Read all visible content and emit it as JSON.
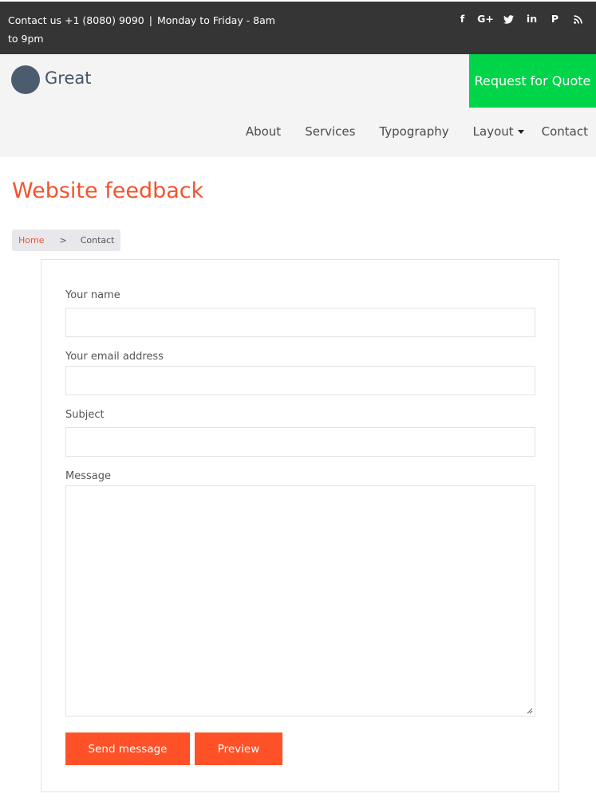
{
  "topbar": {
    "contact": "Contact us +1 (8080) 9090",
    "separator": "|",
    "hours": "Monday to Friday - 8am to 9pm",
    "social": [
      {
        "icon": "facebook-icon",
        "glyph": "f"
      },
      {
        "icon": "google-plus-icon",
        "glyph": "G+"
      },
      {
        "icon": "twitter-icon",
        "glyph": ""
      },
      {
        "icon": "linkedin-icon",
        "glyph": "in"
      },
      {
        "icon": "pinterest-icon",
        "glyph": "P"
      },
      {
        "icon": "rss-icon",
        "glyph": ""
      }
    ]
  },
  "header": {
    "logo_text": "Great",
    "quote_button": "Request for Quote",
    "nav": [
      "About",
      "Services",
      "Typography",
      "Layout",
      "Contact"
    ]
  },
  "page": {
    "title": "Website feedback",
    "breadcrumb": {
      "home": "Home",
      "separator": ">",
      "current": "Contact"
    }
  },
  "form": {
    "name_label": "Your name",
    "email_label": "Your email address",
    "subject_label": "Subject",
    "message_label": "Message",
    "name_value": "",
    "email_value": "",
    "subject_value": "",
    "message_value": "",
    "send_button": "Send message",
    "preview_button": "Preview"
  },
  "colors": {
    "topbar_bg": "#353535",
    "accent": "#f2542d",
    "button": "#ff5127",
    "quote_green": "#00d449"
  }
}
